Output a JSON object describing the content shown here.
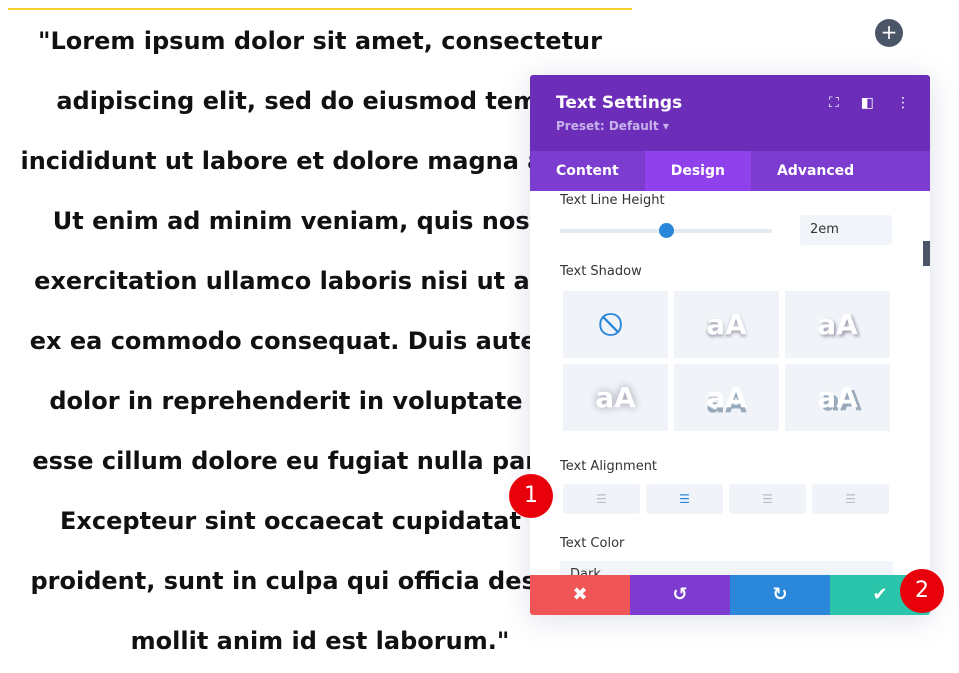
{
  "page": {
    "text_lines": [
      "\"Lorem ipsum dolor sit amet, consectetur",
      "adipiscing elit, sed do eiusmod tempor",
      "incididunt ut labore et dolore magna aliqua.",
      "Ut enim ad minim veniam, quis nostrud",
      "exercitation ullamco laboris nisi ut aliquip",
      "ex ea commodo consequat. Duis aute irure",
      "dolor in reprehenderit in voluptate velit",
      "esse cillum dolore eu fugiat nulla pariatur.",
      "Excepteur sint occaecat cupidatat non",
      "proident, sunt in culpa qui officia deserunt",
      "mollit anim id est laborum.\""
    ],
    "add_icon": "+"
  },
  "panel": {
    "title": "Text Settings",
    "preset": "Preset: Default ▾",
    "tabs": [
      "Content",
      "Design",
      "Advanced"
    ],
    "active_tab": "Design",
    "line_height_label": "Text Line Height",
    "line_height_value": "2em",
    "line_height_slider_fraction": 0.5,
    "shadow_label": "Text Shadow",
    "shadow_preview": "aA",
    "alignment_label": "Text Alignment",
    "alignment_selected": "center",
    "color_label": "Text Color",
    "color_value": "Dark"
  },
  "footer": {
    "cancel": "✖",
    "undo": "↺",
    "redo": "↻",
    "save": "✔"
  },
  "badges": [
    "1",
    "2"
  ],
  "colors": {
    "header": "#6c2eb9",
    "tabs": "#7b3ccf",
    "active_tab": "#8f42ec",
    "cancel": "#ef5555",
    "undo": "#7d3bcf",
    "redo": "#2b87da",
    "save": "#29c4a9",
    "badge": "#e8000b"
  }
}
